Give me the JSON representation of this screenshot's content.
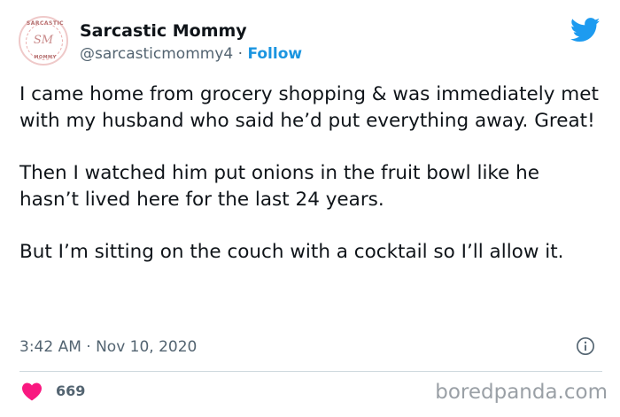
{
  "author": {
    "display_name": "Sarcastic Mommy",
    "handle": "@sarcasticmommy4",
    "separator": " · ",
    "follow_label": "Follow",
    "avatar_text_top": "SARCASTIC",
    "avatar_monogram": "SM",
    "avatar_text_bottom": "MOMMY"
  },
  "tweet": {
    "paragraphs": [
      "I came home from grocery shopping & was immediately met with my husband who said he’d put everything away. Great!",
      "Then I watched him put onions in the fruit bowl like he hasn’t lived here for the last 24 years.",
      "But I’m sitting on the couch with a cocktail so I’ll allow it."
    ],
    "timestamp": "3:42 AM · Nov 10, 2020",
    "likes": "669"
  },
  "icons": {
    "brand": "twitter-bird-icon",
    "info": "info-icon",
    "like": "heart-icon"
  },
  "watermark": "boredpanda.com",
  "colors": {
    "twitter_blue": "#1d9bf0",
    "follow_blue": "#1b95e0",
    "heart_red": "#f91880",
    "secondary_text": "#536471"
  }
}
